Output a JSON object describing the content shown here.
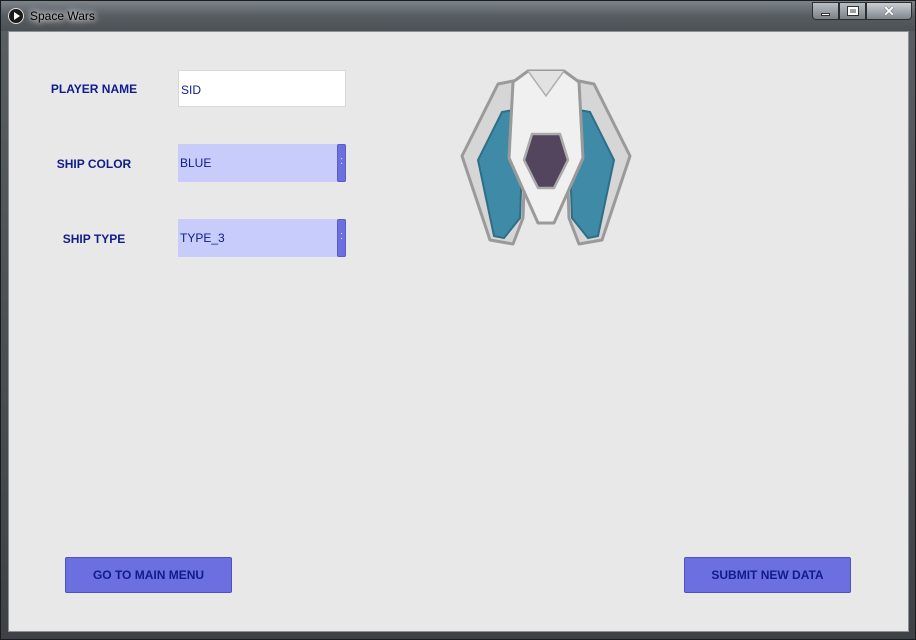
{
  "window": {
    "title": "Space Wars",
    "close_glyph": "✕"
  },
  "form": {
    "player_name_label": "PLAYER NAME",
    "player_name_value": "SID",
    "ship_color_label": "SHIP COLOR",
    "ship_color_value": "BLUE",
    "ship_type_label": "SHIP TYPE",
    "ship_type_value": "TYPE_3"
  },
  "buttons": {
    "main_menu": "GO TO MAIN MENU",
    "submit": "SUBMIT NEW DATA"
  },
  "colors": {
    "accent": "#6c6fe0",
    "label_text": "#0f1c8c",
    "ship_blue": "#3f8aa6",
    "ship_cockpit": "#54455f"
  },
  "icons": {
    "app": "play-circle-icon",
    "ship": "spaceship-preview"
  }
}
